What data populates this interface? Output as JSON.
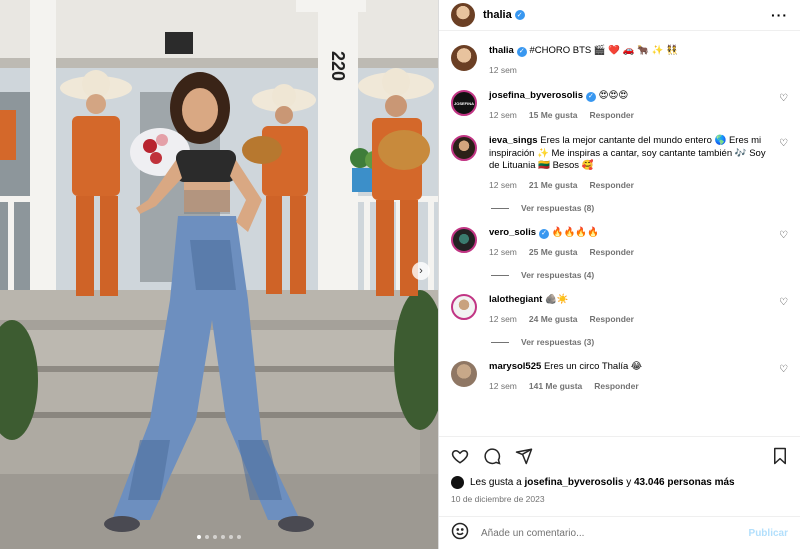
{
  "header": {
    "username": "thalia",
    "more_icon": "more-horizontal-icon"
  },
  "caption": {
    "username": "thalia",
    "text": "#CHORO BTS 🎬 ❤️ 🚗 🐂 ✨ 👯",
    "time": "12 sem"
  },
  "comments": [
    {
      "username": "josefina_byverosolis",
      "verified": true,
      "text": "😍😍😍",
      "time": "12 sem",
      "likes": "15 Me gusta",
      "reply": "Responder",
      "avatar_label": "JOSEFINA"
    },
    {
      "username": "ieva_sings",
      "verified": false,
      "text": "Eres la mejor cantante del mundo entero 🌎 Eres mi inspiración ✨ Me inspiras a cantar, soy cantante también 🎶 Soy de Lituania 🇱🇹 Besos 🥰",
      "time": "12 sem",
      "likes": "21 Me gusta",
      "reply": "Responder",
      "view_replies": "Ver respuestas (8)"
    },
    {
      "username": "vero_solis",
      "verified": true,
      "text": "🔥🔥🔥🔥",
      "time": "12 sem",
      "likes": "25 Me gusta",
      "reply": "Responder",
      "view_replies": "Ver respuestas (4)"
    },
    {
      "username": "lalothegiant",
      "verified": false,
      "text": "🪨☀️",
      "time": "12 sem",
      "likes": "24 Me gusta",
      "reply": "Responder",
      "view_replies": "Ver respuestas (3)"
    },
    {
      "username": "marysol525",
      "verified": false,
      "text": "Eres un circo Thalía 😂",
      "time": "12 sem",
      "likes": "141 Me gusta",
      "reply": "Responder"
    }
  ],
  "actions": {
    "like": "heart-icon",
    "comment": "comment-icon",
    "share": "share-icon",
    "save": "bookmark-icon"
  },
  "likes_line": {
    "prefix": "Les gusta a",
    "user": "josefina_byverosolis",
    "middle": "y",
    "count": "43.046 personas más"
  },
  "date": "10 de diciembre de 2023",
  "composer": {
    "placeholder": "Añade un comentario...",
    "publish": "Publicar"
  },
  "photo": {
    "house_number": "220",
    "carousel_dots": 6,
    "active_dot": 0
  },
  "colors": {
    "verified": "#3897f0",
    "story_ring": "#c13584",
    "publish_disabled": "#b2dffc",
    "muted": "#737373"
  }
}
